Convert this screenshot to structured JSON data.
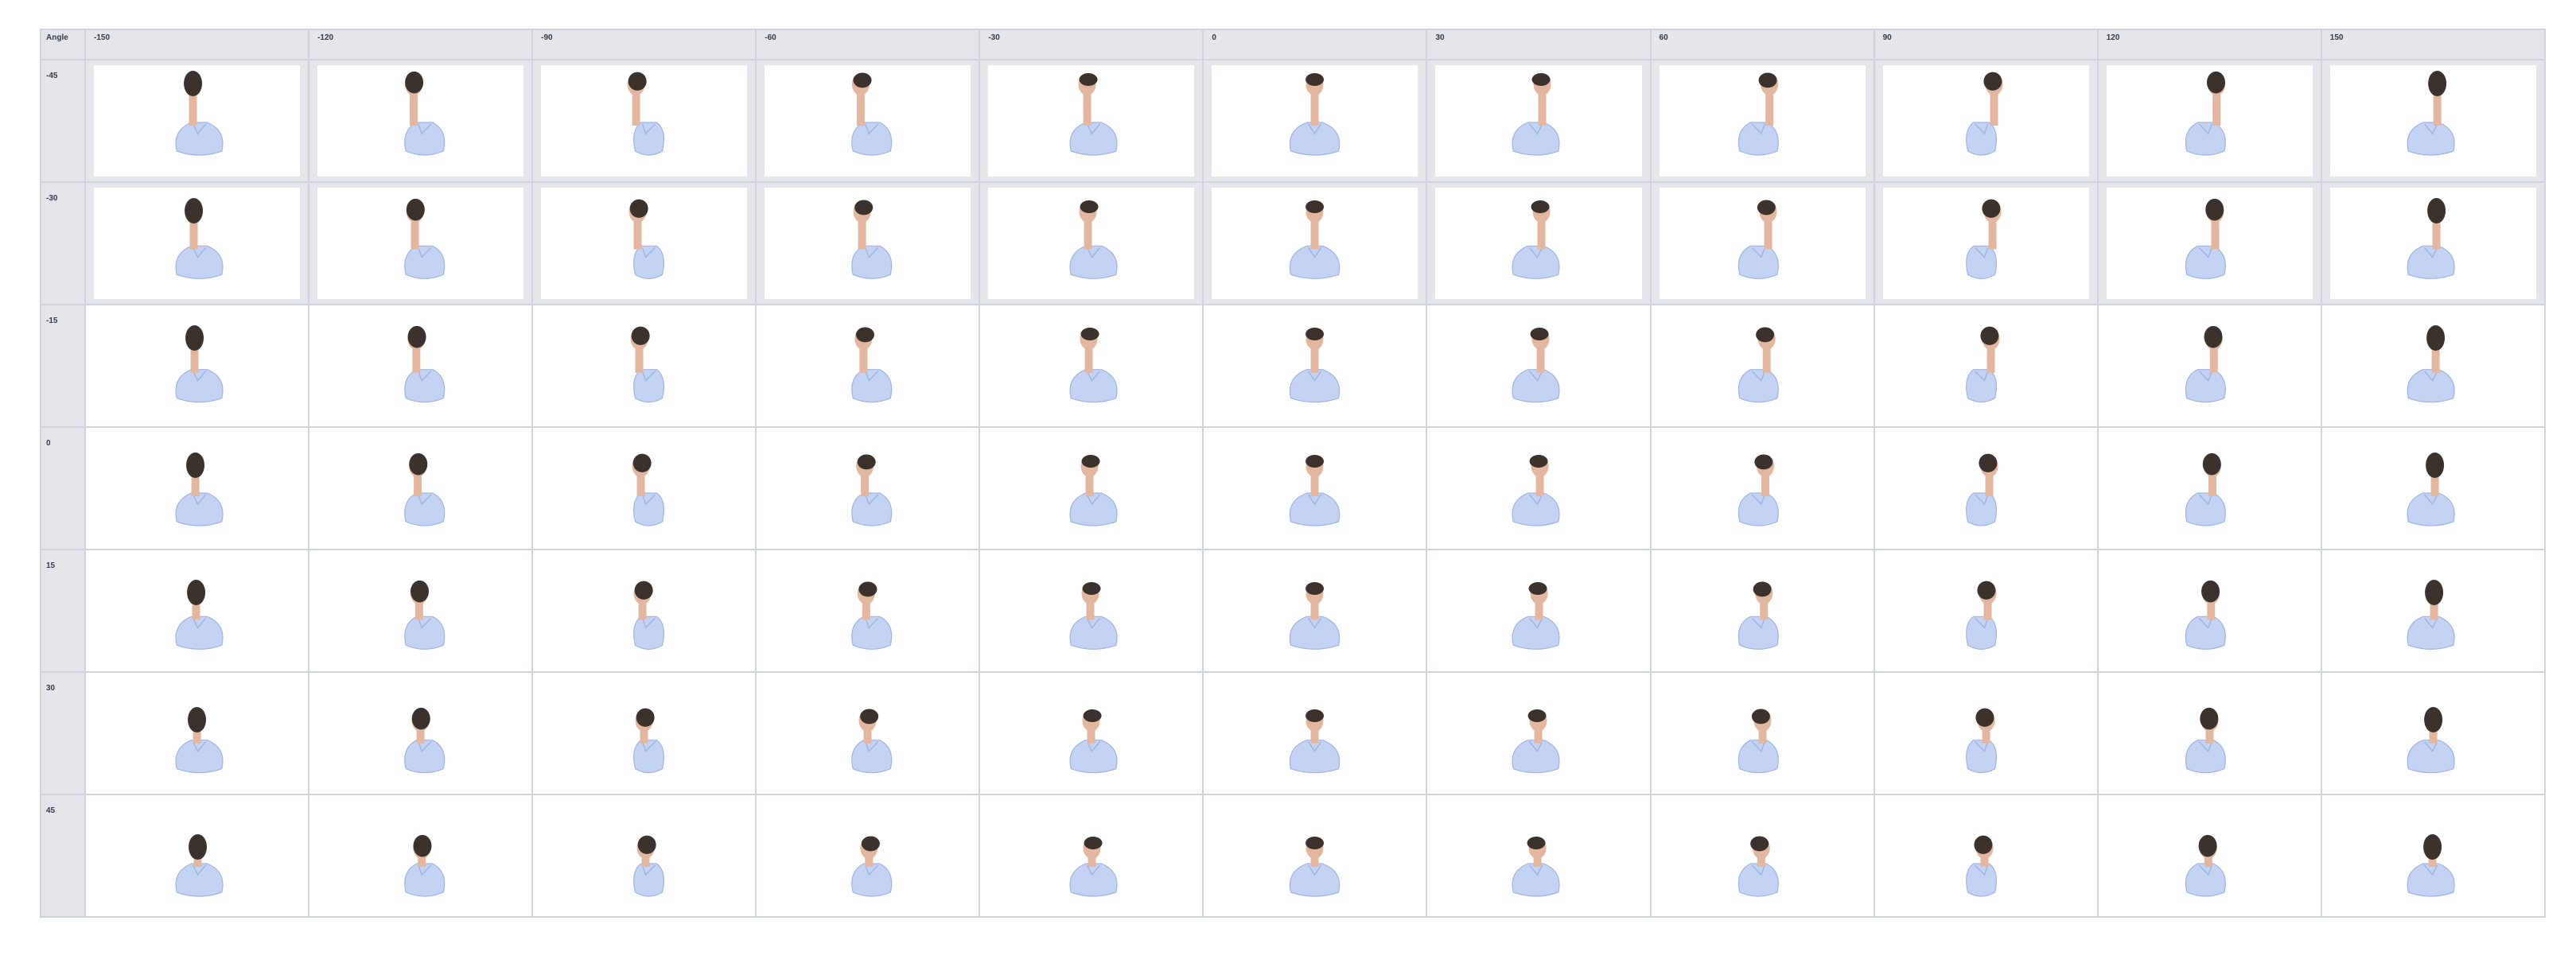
{
  "table": {
    "corner_label": "Angle",
    "columns": [
      "-150",
      "-120",
      "-90",
      "-60",
      "-30",
      "0",
      "30",
      "60",
      "90",
      "120",
      "150"
    ],
    "rows": [
      {
        "label": "-45",
        "shaded": true
      },
      {
        "label": "-30",
        "shaded": true
      },
      {
        "label": "-15",
        "shaded": false
      },
      {
        "label": "0",
        "shaded": false
      },
      {
        "label": "15",
        "shaded": false
      },
      {
        "label": "30",
        "shaded": false
      },
      {
        "label": "45",
        "shaded": false
      }
    ]
  },
  "colors": {
    "shirt": "#c4d3f3",
    "shirt_shadow": "#9fb4e2",
    "hair": "#3b322d",
    "skin": "#e3b79f",
    "header_bg": "#e4e6ec",
    "grid_line": "#cfd3db"
  }
}
